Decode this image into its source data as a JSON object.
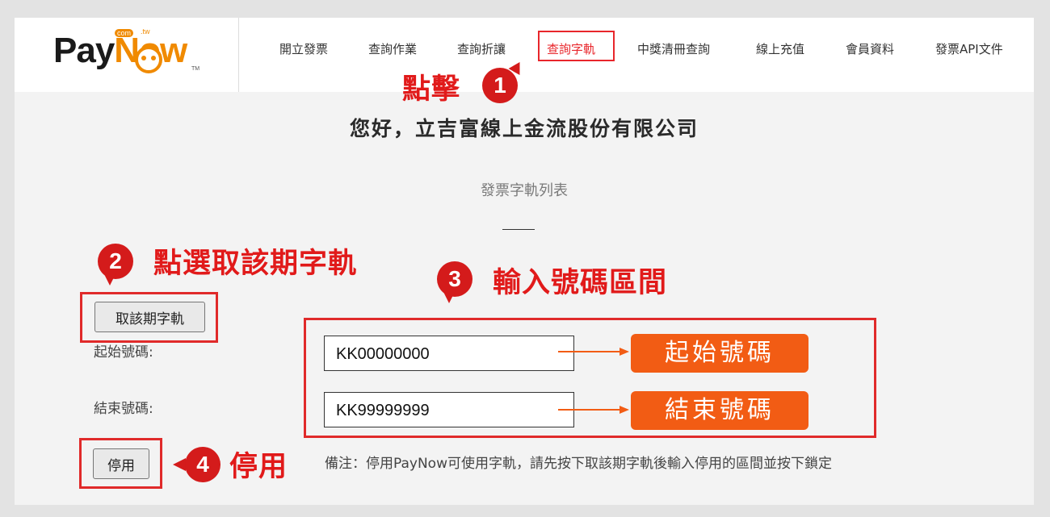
{
  "brand": {
    "logo_main": "Pay",
    "logo_now": "Now",
    "logo_com": "com",
    "logo_tw": ".tw",
    "logo_tm": "TM"
  },
  "nav": {
    "items": [
      {
        "label": "開立發票"
      },
      {
        "label": "查詢作業"
      },
      {
        "label": "查詢折讓"
      },
      {
        "label": "查詢字軌",
        "active": true
      },
      {
        "label": "中獎清冊查詢"
      },
      {
        "label": "線上充值"
      },
      {
        "label": "會員資料"
      },
      {
        "label": "發票API文件"
      }
    ]
  },
  "main": {
    "greeting": "您好，立吉富線上金流股份有限公司",
    "list_title": "發票字軌列表",
    "fetch_button": "取該期字軌",
    "start_label": "起始號碼:",
    "end_label": "結束號碼:",
    "start_value": "KK00000000",
    "end_value": "KK99999999",
    "disable_button": "停用",
    "note": "備注：停用PayNow可使用字軌，請先按下取該期字軌後輸入停用的區間並按下鎖定"
  },
  "annotations": {
    "step1_text": "點擊",
    "step1_num": "1",
    "step2_text": "點選取該期字軌",
    "step2_num": "2",
    "step3_text": "輸入號碼區間",
    "step3_num": "3",
    "step4_text": "停用",
    "step4_num": "4",
    "start_tag": "起始號碼",
    "end_tag": "結束號碼"
  },
  "colors": {
    "accent_red": "#e8262b",
    "annotation_red": "#d41b1b",
    "tag_orange": "#f25c14",
    "brand_orange": "#f08a00"
  }
}
